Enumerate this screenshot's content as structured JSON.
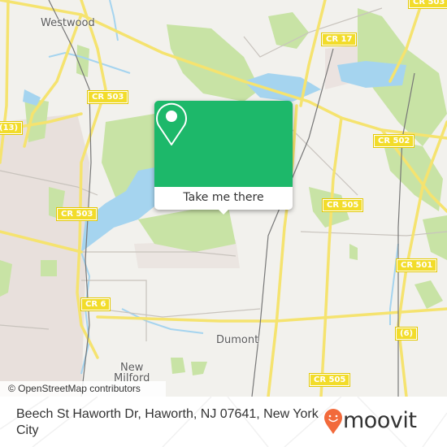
{
  "map": {
    "place_labels": [
      {
        "name": "westwood",
        "text": "Westwood"
      },
      {
        "name": "dumont",
        "text": "Dumont"
      },
      {
        "name": "new-milford",
        "text": "New\nMilford"
      }
    ],
    "road_labels": [
      {
        "name": "cr-503-top",
        "text": "CR 503"
      },
      {
        "name": "cr-503-left",
        "text": "CR 503"
      },
      {
        "name": "cr-17",
        "text": "CR 17"
      },
      {
        "name": "cr-503-topright",
        "text": "CR 503"
      },
      {
        "name": "cr-502",
        "text": "CR 502"
      },
      {
        "name": "cr-505-mid",
        "text": "CR 505"
      },
      {
        "name": "cr-501",
        "text": "CR 501"
      },
      {
        "name": "route-6",
        "text": "(6)"
      },
      {
        "name": "cr-505-bottom",
        "text": "CR 505"
      },
      {
        "name": "cr-6",
        "text": "CR 6"
      },
      {
        "name": "route-13",
        "text": "(13)"
      }
    ],
    "attribution": "© OpenStreetMap contributors",
    "colors": {
      "land": "#f2f1ed",
      "park": "#c8e3a5",
      "water": "#a5d4ef",
      "urban": "#e8e0dc",
      "road": "#f5e36f",
      "rail": "#777777"
    }
  },
  "popup": {
    "icon": "location-pin-icon",
    "button_label": "Take me there",
    "color": "#1db86a"
  },
  "footer": {
    "address": "Beech St Haworth Dr, Haworth, NJ 07641, New York City",
    "brand": "moovit",
    "brand_color": "#f26a3b"
  }
}
